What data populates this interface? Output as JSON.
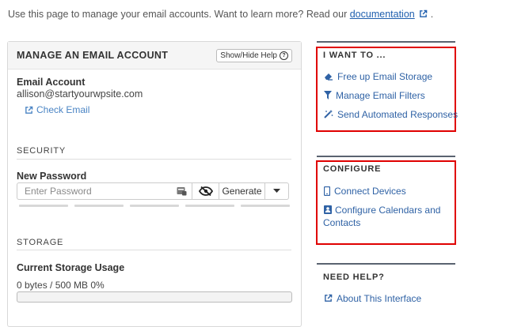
{
  "intro": {
    "text": "Use this page to manage your email accounts. Want to learn more? Read our",
    "link": "documentation",
    "trail": "."
  },
  "panel": {
    "title": "MANAGE AN EMAIL ACCOUNT",
    "help_button": "Show/Hide Help",
    "email_label": "Email Account",
    "email_value": "allison@startyourwpsite.com",
    "check_email": "Check Email",
    "security_heading": "SECURITY",
    "new_password_label": "New Password",
    "password_placeholder": "Enter Password",
    "generate_label": "Generate",
    "storage_heading": "STORAGE",
    "storage_label": "Current Storage Usage",
    "storage_value": "0 bytes / 500 MB 0%",
    "storage_fraction": 0
  },
  "sidebar": {
    "i_want_to": {
      "heading": "I WANT TO ...",
      "items": [
        {
          "label": "Free up Email Storage",
          "icon": "eraser-icon"
        },
        {
          "label": "Manage Email Filters",
          "icon": "filter-icon"
        },
        {
          "label": "Send Automated Responses",
          "icon": "magic-wand-icon"
        }
      ]
    },
    "configure": {
      "heading": "CONFIGURE",
      "items": [
        {
          "label": "Connect Devices",
          "icon": "mobile-icon"
        },
        {
          "label": "Configure Calendars and Contacts",
          "icon": "address-book-icon"
        }
      ]
    },
    "need_help": {
      "heading": "NEED HELP?",
      "items": [
        {
          "label": "About This Interface",
          "icon": "external-link-icon"
        }
      ]
    }
  },
  "colors": {
    "link": "#2f62a5",
    "highlight_border": "#e00000",
    "divider": "#5a6370"
  }
}
